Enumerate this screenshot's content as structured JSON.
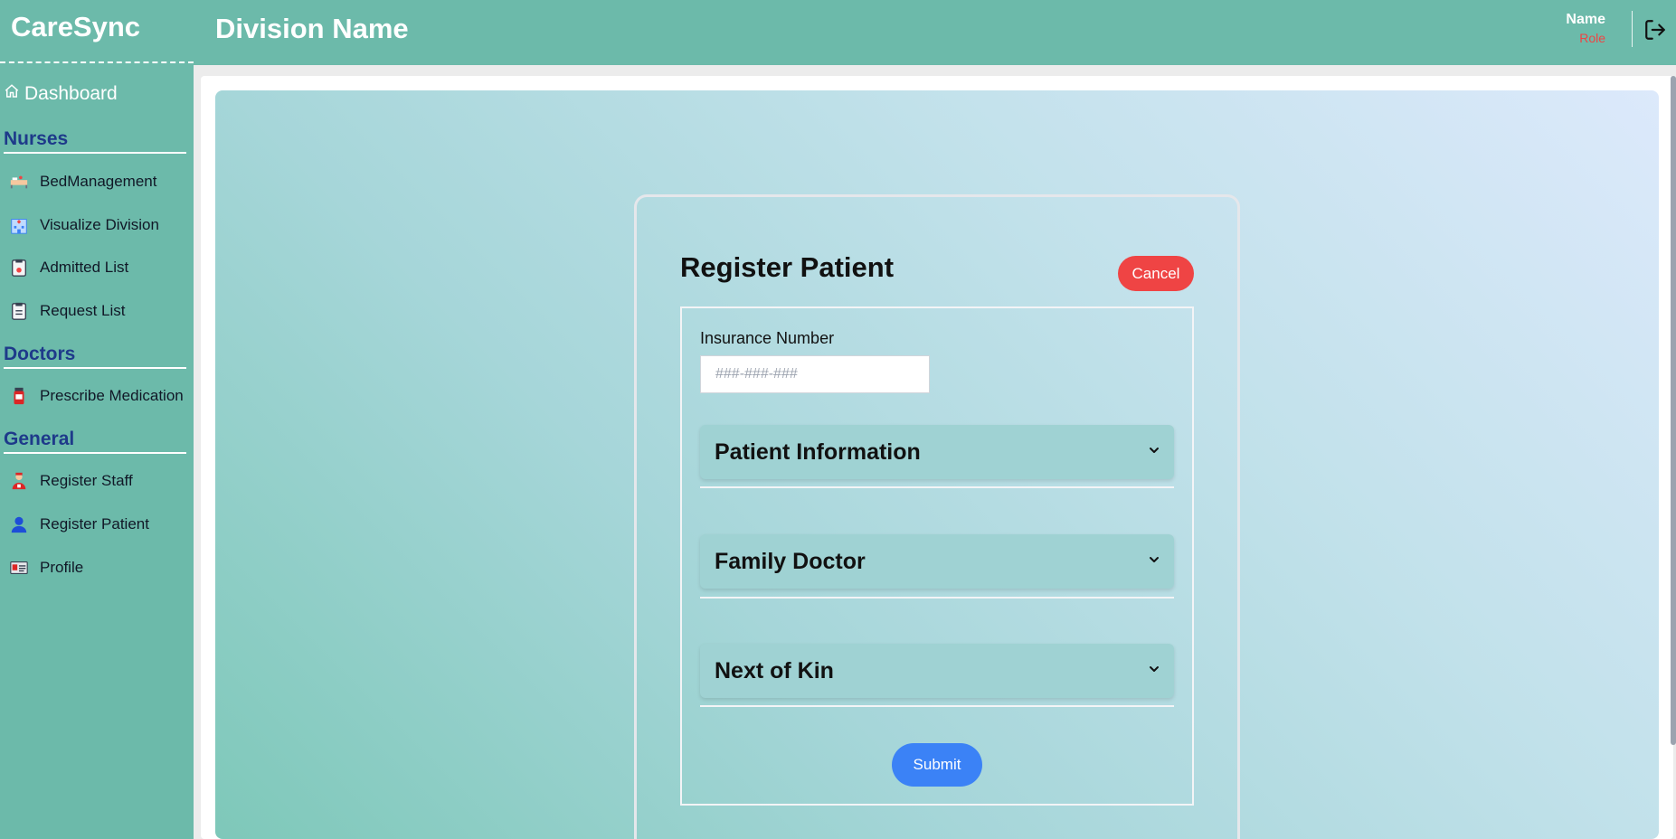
{
  "app": {
    "brand": "CareSync"
  },
  "header": {
    "division_title": "Division Name",
    "user_name": "Name",
    "user_role": "Role"
  },
  "sidebar": {
    "dashboard_label": "Dashboard",
    "sections": [
      {
        "title": "Nurses",
        "items": [
          {
            "label": "BedManagement",
            "icon": "bed-icon"
          },
          {
            "label": "Visualize Division",
            "icon": "hospital-icon"
          },
          {
            "label": "Admitted List",
            "icon": "clipboard-icon"
          },
          {
            "label": "Request List",
            "icon": "clipboard-icon"
          }
        ]
      },
      {
        "title": "Doctors",
        "items": [
          {
            "label": "Prescribe Medication",
            "icon": "medicine-bottle-icon"
          }
        ]
      },
      {
        "title": "General",
        "items": [
          {
            "label": "Register Staff",
            "icon": "staff-icon"
          },
          {
            "label": "Register Patient",
            "icon": "user-icon"
          },
          {
            "label": "Profile",
            "icon": "id-card-icon"
          }
        ]
      }
    ]
  },
  "form": {
    "title": "Register Patient",
    "cancel_label": "Cancel",
    "insurance_label": "Insurance Number",
    "insurance_placeholder": "###-###-###",
    "insurance_value": "",
    "sections": [
      "Patient Information",
      "Family Doctor",
      "Next of Kin"
    ],
    "submit_label": "Submit"
  },
  "colors": {
    "teal": "#6cbaaa",
    "section_title": "#1e3a8a",
    "cancel": "#ef4444",
    "submit": "#3b82f6",
    "role": "#ef4444"
  }
}
